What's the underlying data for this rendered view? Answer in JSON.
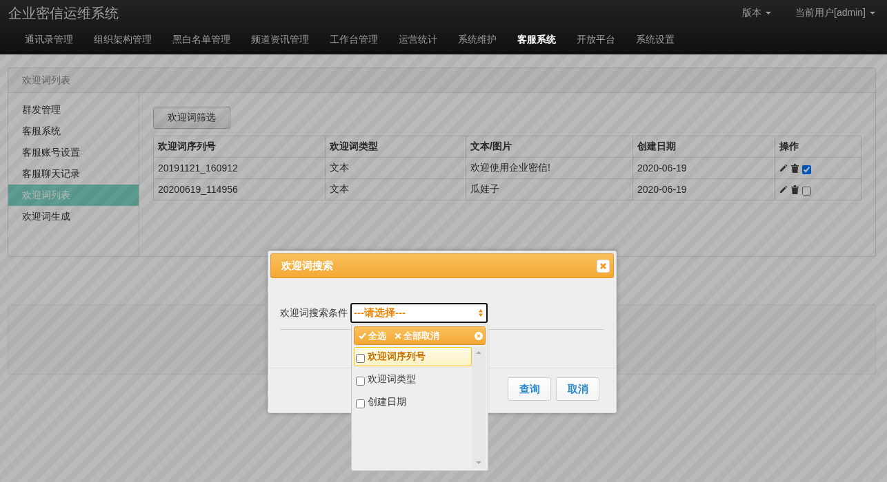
{
  "navbar": {
    "title": "企业密信运维系统",
    "right_menus": [
      {
        "label": "版本"
      },
      {
        "label": "当前用户[admin]"
      }
    ],
    "nav_items": [
      {
        "label": "通讯录管理",
        "selected": false
      },
      {
        "label": "组织架构管理",
        "selected": false
      },
      {
        "label": "黑白名单管理",
        "selected": false
      },
      {
        "label": "频道资讯管理",
        "selected": false
      },
      {
        "label": "工作台管理",
        "selected": false
      },
      {
        "label": "运营统计",
        "selected": false
      },
      {
        "label": "系统维护",
        "selected": false
      },
      {
        "label": "客服系统",
        "selected": true
      },
      {
        "label": "开放平台",
        "selected": false
      },
      {
        "label": "系统设置",
        "selected": false
      }
    ]
  },
  "panel": {
    "title": "欢迎词列表",
    "sidebar": {
      "items": [
        {
          "label": "群发管理",
          "selected": false
        },
        {
          "label": "客服系统",
          "selected": false
        },
        {
          "label": "客服账号设置",
          "selected": false
        },
        {
          "label": "客服聊天记录",
          "selected": false
        },
        {
          "label": "欢迎词列表",
          "selected": true
        },
        {
          "label": "欢迎词生成",
          "selected": false
        }
      ]
    },
    "filter_button": "欢迎词筛选",
    "table": {
      "columns": [
        "欢迎词序列号",
        "欢迎词类型",
        "文本/图片",
        "创建日期",
        "操作"
      ],
      "rows": [
        {
          "cells": [
            "20191121_160912",
            "文本",
            "欢迎使用企业密信!",
            "2020-06-19"
          ],
          "checked": true
        },
        {
          "cells": [
            "20200619_114956",
            "文本",
            "瓜娃子",
            "2020-06-19"
          ],
          "checked": false
        }
      ]
    }
  },
  "dialog": {
    "title": "欢迎词搜索",
    "field_label": "欢迎词搜索条件",
    "select": {
      "placeholder": "---请选择---",
      "expanded": true,
      "select_all": "全选",
      "deselect_all": "全部取消",
      "options": [
        {
          "label": "欢迎词序列号",
          "checked": false,
          "highlighted": true
        },
        {
          "label": "欢迎词类型",
          "checked": false,
          "highlighted": false
        },
        {
          "label": "创建日期",
          "checked": false,
          "highlighted": false
        }
      ]
    },
    "buttons": [
      "查询",
      "取消"
    ]
  }
}
